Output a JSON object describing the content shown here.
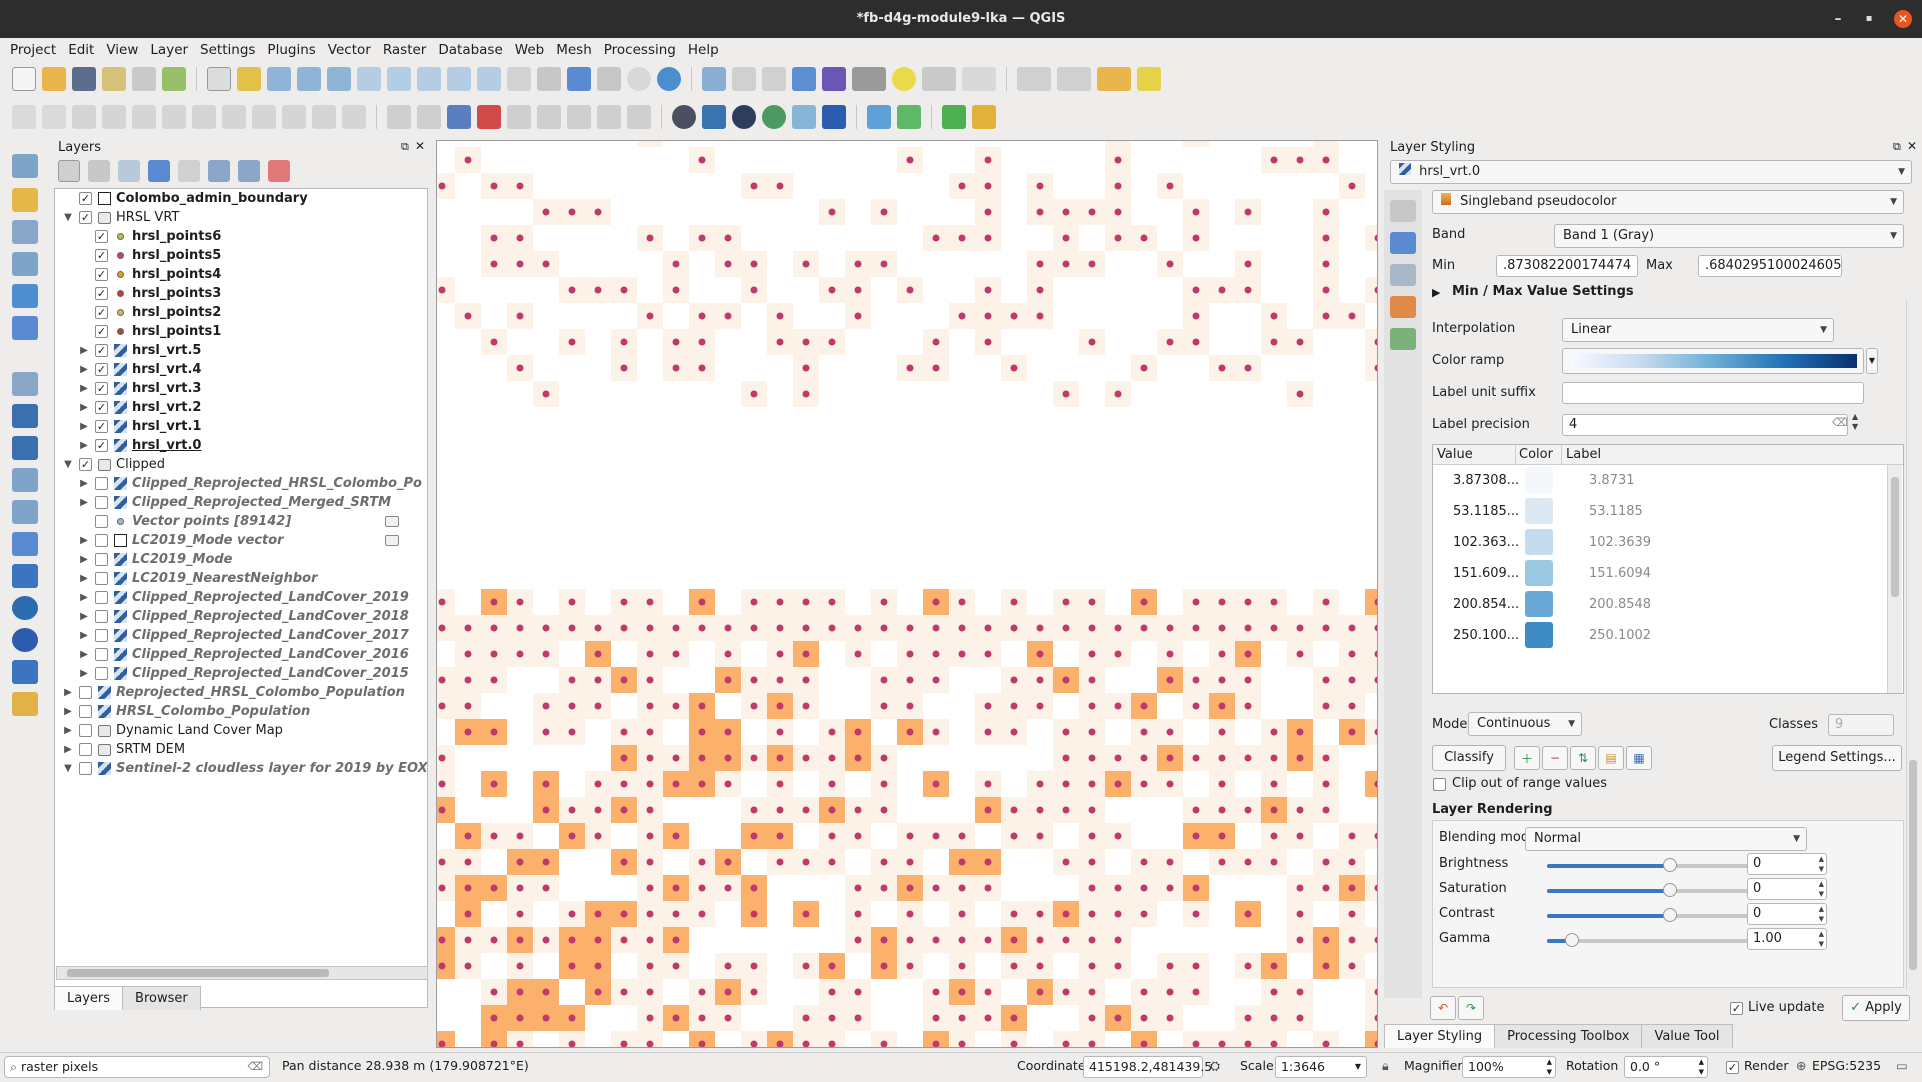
{
  "window": {
    "title": "*fb-d4g-module9-lka — QGIS",
    "minimize": "–",
    "maximize": "▪",
    "close": "✕"
  },
  "menubar": [
    "Project",
    "Edit",
    "View",
    "Layer",
    "Settings",
    "Plugins",
    "Vector",
    "Raster",
    "Database",
    "Web",
    "Mesh",
    "Processing",
    "Help"
  ],
  "layers_panel": {
    "title": "Layers",
    "items": [
      {
        "label": "Colombo_admin_boundary",
        "checked": true,
        "style": "bold",
        "indent": 0,
        "expander": "",
        "icon": "polygon-layer-icon"
      },
      {
        "label": "HRSL VRT",
        "checked": true,
        "style": "normal",
        "indent": 0,
        "expander": "▼",
        "icon": "group-icon"
      },
      {
        "label": "hrsl_points6",
        "checked": true,
        "style": "bold",
        "indent": 1,
        "expander": "",
        "icon": "point-layer-icon",
        "color": "#b7c43c"
      },
      {
        "label": "hrsl_points5",
        "checked": true,
        "style": "bold",
        "indent": 1,
        "expander": "",
        "icon": "point-layer-icon",
        "color": "#d03a7c"
      },
      {
        "label": "hrsl_points4",
        "checked": true,
        "style": "bold",
        "indent": 1,
        "expander": "",
        "icon": "point-layer-icon",
        "color": "#e0a020"
      },
      {
        "label": "hrsl_points3",
        "checked": true,
        "style": "bold",
        "indent": 1,
        "expander": "",
        "icon": "point-layer-icon",
        "color": "#c83a2a"
      },
      {
        "label": "hrsl_points2",
        "checked": true,
        "style": "bold",
        "indent": 1,
        "expander": "",
        "icon": "point-layer-icon",
        "color": "#d8b55a"
      },
      {
        "label": "hrsl_points1",
        "checked": true,
        "style": "bold",
        "indent": 1,
        "expander": "",
        "icon": "point-layer-icon",
        "color": "#a0522d"
      },
      {
        "label": "hrsl_vrt.5",
        "checked": true,
        "style": "bold",
        "indent": 1,
        "expander": "▶",
        "icon": "raster-layer-icon"
      },
      {
        "label": "hrsl_vrt.4",
        "checked": true,
        "style": "bold",
        "indent": 1,
        "expander": "▶",
        "icon": "raster-layer-icon"
      },
      {
        "label": "hrsl_vrt.3",
        "checked": true,
        "style": "bold",
        "indent": 1,
        "expander": "▶",
        "icon": "raster-layer-icon"
      },
      {
        "label": "hrsl_vrt.2",
        "checked": true,
        "style": "bold",
        "indent": 1,
        "expander": "▶",
        "icon": "raster-layer-icon"
      },
      {
        "label": "hrsl_vrt.1",
        "checked": true,
        "style": "bold",
        "indent": 1,
        "expander": "▶",
        "icon": "raster-layer-icon"
      },
      {
        "label": "hrsl_vrt.0",
        "checked": true,
        "style": "bold-underline",
        "indent": 1,
        "expander": "▶",
        "icon": "raster-layer-icon"
      },
      {
        "label": "Clipped",
        "checked": true,
        "style": "normal",
        "indent": 0,
        "expander": "▼",
        "icon": "group-icon"
      },
      {
        "label": "Clipped_Reprojected_HRSL_Colombo_Po",
        "checked": false,
        "style": "italic",
        "indent": 1,
        "expander": "▶",
        "icon": "raster-layer-icon"
      },
      {
        "label": "Clipped_Reprojected_Merged_SRTM",
        "checked": false,
        "style": "italic",
        "indent": 1,
        "expander": "▶",
        "icon": "raster-layer-icon"
      },
      {
        "label": "Vector points [89142]",
        "checked": false,
        "style": "italic",
        "indent": 1,
        "expander": "",
        "icon": "point-layer-icon",
        "color": "#9bb8d6"
      },
      {
        "label": "LC2019_Mode vector",
        "checked": false,
        "style": "italic",
        "indent": 1,
        "expander": "▶",
        "icon": "polygon-layer-icon"
      },
      {
        "label": "LC2019_Mode",
        "checked": false,
        "style": "italic",
        "indent": 1,
        "expander": "▶",
        "icon": "raster-layer-icon"
      },
      {
        "label": "LC2019_NearestNeighbor",
        "checked": false,
        "style": "italic",
        "indent": 1,
        "expander": "▶",
        "icon": "raster-layer-icon"
      },
      {
        "label": "Clipped_Reprojected_LandCover_2019",
        "checked": false,
        "style": "italic",
        "indent": 1,
        "expander": "▶",
        "icon": "raster-layer-icon"
      },
      {
        "label": "Clipped_Reprojected_LandCover_2018",
        "checked": false,
        "style": "italic",
        "indent": 1,
        "expander": "▶",
        "icon": "raster-layer-icon"
      },
      {
        "label": "Clipped_Reprojected_LandCover_2017",
        "checked": false,
        "style": "italic",
        "indent": 1,
        "expander": "▶",
        "icon": "raster-layer-icon"
      },
      {
        "label": "Clipped_Reprojected_LandCover_2016",
        "checked": false,
        "style": "italic",
        "indent": 1,
        "expander": "▶",
        "icon": "raster-layer-icon"
      },
      {
        "label": "Clipped_Reprojected_LandCover_2015",
        "checked": false,
        "style": "italic",
        "indent": 1,
        "expander": "▶",
        "icon": "raster-layer-icon"
      },
      {
        "label": "Reprojected_HRSL_Colombo_Population",
        "checked": false,
        "style": "italic",
        "indent": 0,
        "expander": "▶",
        "icon": "raster-layer-icon"
      },
      {
        "label": "HRSL_Colombo_Population",
        "checked": false,
        "style": "italic",
        "indent": 0,
        "expander": "▶",
        "icon": "raster-layer-icon"
      },
      {
        "label": "Dynamic Land Cover Map",
        "checked": false,
        "style": "normal",
        "indent": 0,
        "expander": "▶",
        "icon": "group-icon"
      },
      {
        "label": "SRTM DEM",
        "checked": false,
        "style": "normal",
        "indent": 0,
        "expander": "▶",
        "icon": "group-icon"
      },
      {
        "label": "Sentinel-2 cloudless layer for 2019 by EOX",
        "checked": false,
        "style": "italic",
        "indent": 0,
        "expander": "▼",
        "icon": "raster-layer-icon"
      }
    ],
    "tabs": [
      "Layers",
      "Browser"
    ]
  },
  "styling": {
    "title": "Layer Styling",
    "layer": "hrsl_vrt.0",
    "renderer": "Singleband pseudocolor",
    "band_label": "Band",
    "band": "Band 1 (Gray)",
    "min_label": "Min",
    "min": ".873082200174474",
    "max_label": "Max",
    "max": ".6840295100024605",
    "minmax_settings": "Min / Max Value Settings",
    "interp_label": "Interpolation",
    "interp": "Linear",
    "ramp_label": "Color ramp",
    "suffix_label": "Label unit suffix",
    "suffix": "",
    "precision_label": "Label precision",
    "precision": "4",
    "col_value": "Value",
    "col_color": "Color",
    "col_label": "Label",
    "rows": [
      {
        "value": "3.87308...",
        "color": "#f4f8fc",
        "label": "3.8731"
      },
      {
        "value": "53.1185...",
        "color": "#dce8f4",
        "label": "53.1185"
      },
      {
        "value": "102.363...",
        "color": "#c4dcef",
        "label": "102.3639"
      },
      {
        "value": "151.609...",
        "color": "#9ac8e2",
        "label": "151.6094"
      },
      {
        "value": "200.854...",
        "color": "#6aa9d5",
        "label": "200.8548"
      },
      {
        "value": "250.100...",
        "color": "#3e8bc5",
        "label": "250.1002"
      }
    ],
    "mode_label": "Mode",
    "mode": "Continuous",
    "classes_label": "Classes",
    "classes": "9",
    "classify": "Classify",
    "legend_settings": "Legend Settings...",
    "clip_label": "Clip out of range values",
    "rendering_header": "Layer Rendering",
    "blend_label": "Blending mode",
    "blend": "Normal",
    "brightness_label": "Brightness",
    "brightness": "0",
    "saturation_label": "Saturation",
    "saturation": "0",
    "contrast_label": "Contrast",
    "contrast": "0",
    "gamma_label": "Gamma",
    "gamma": "1.00",
    "live_update": "Live update",
    "apply": "Apply",
    "tabs": [
      "Layer Styling",
      "Processing Toolbox",
      "Value Tool"
    ]
  },
  "status": {
    "search_placeholder": "raster pixels",
    "message": "Pan distance 28.938 m (179.908721°E)",
    "coord_label": "Coordinate",
    "coord": "415198.2,481439.5",
    "scale_label": "Scale",
    "scale": "1:3646",
    "magnifier_label": "Magnifier",
    "magnifier": "100%",
    "rotation_label": "Rotation",
    "rotation": "0.0 °",
    "render_label": "Render",
    "crs": "EPSG:5235"
  },
  "map": {
    "light_color": "#fdf2e8",
    "dark_color": "#fbb06b",
    "dot_color": "#c2386a",
    "light_pixels": "26 130,34 130,39 130,45 130,58 130,63 130,66 130,69 130,26 134,34 130,23 134,25 134,38 134,40 134,42 134,47 134,49 134,52 134,55 134,58 134,61 134,63 134,65 134,68 134,70 134,72 134,60 134,20 138,31 138,24 138,35 138,41 138,47 138,50 138,54 138,57 138,63 138,66 138,71 138,74 138,80 138,16 142,21 142,29 142,34 142,43 142,45 142,48 142,52 142,56 142,60 142,62 142,64 142,68 142,71 142,76 142,78 142,11 146,17 146,21 146,26 146,31 146,37 146,40 146,46 146,53 146,58 146,62 146,67 146,73 146,77 146,81 146,9 150,15 150,21 150,28 150,31 150,35 150,39 150,43 150,47 150,51 150,53 150,57 150,61 150,66 150,71 150,76 150,79 150,82 150,86 150,8 154,13 154,18 154,23 154,28 154,34 154,38 154,42 154,46 154,50 154,56 154,60 154,66 154,70 154,73 154,77 154,83 154,86 154,7 158,10 158,16 158,21 158,27 158,32 158,36 158,40 158,48 158,51 158,55 158,59 158,62 158,67 158,72 158,79 158,83 158,87 158,7 162,12 162,15 162,19 162,24 162,29 162,31 162,33 162,39 162,47 162,51 162,56 162,59 162,63 162,69 162,73 162,78 162,84 162,88 162"
  }
}
